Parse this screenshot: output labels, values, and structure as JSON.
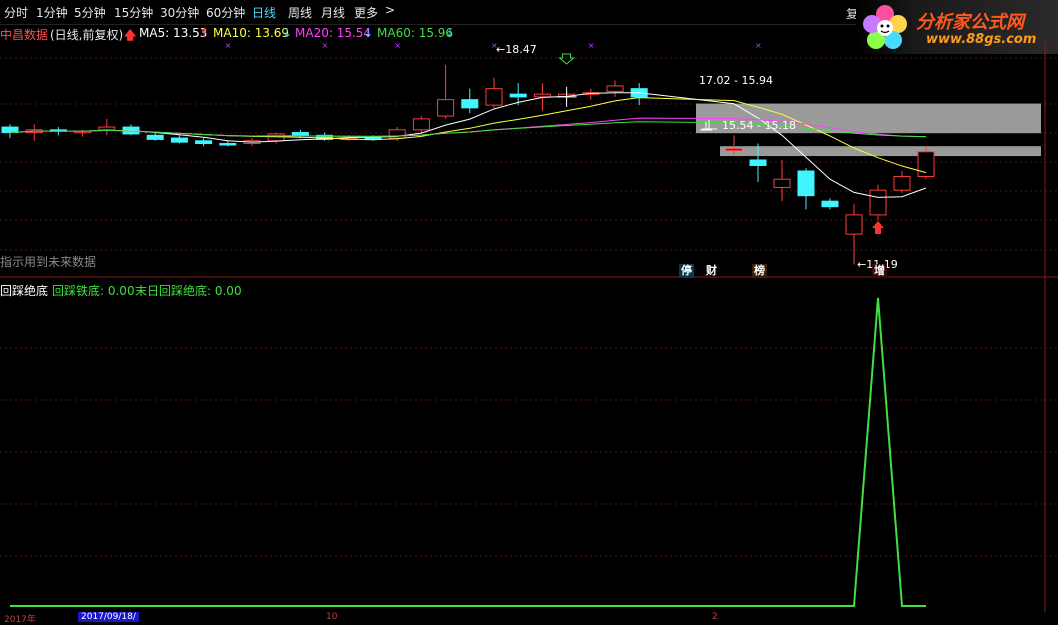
{
  "tabs": [
    "分时",
    "1分钟",
    "5分钟",
    "15分钟",
    "30分钟",
    "60分钟",
    "日线",
    "周线",
    "月线",
    "更多"
  ],
  "active_tab": "日线",
  "restore_label": "复",
  "logo": {
    "brand": "分析家公式网",
    "url": "www.88gs.com"
  },
  "stock": {
    "name": "中昌数据",
    "mode": "(日线,前复权)"
  },
  "ma": [
    {
      "label": "MA5: 13.53",
      "color": "#ffffff",
      "arrow": "↑",
      "arrow_color": "#ff3030"
    },
    {
      "label": "MA10: 13.69",
      "color": "#ffff40",
      "arrow": "↓",
      "arrow_color": "#40d0ff"
    },
    {
      "label": "MA20: 15.54",
      "color": "#ff40ff",
      "arrow": "↓",
      "arrow_color": "#40d0ff"
    },
    {
      "label": "MA60: 15.96",
      "color": "#40e040",
      "arrow": "↓",
      "arrow_color": "#40d0ff"
    }
  ],
  "annotations": {
    "high": "18.47",
    "low": "11.19",
    "zone1": "17.02 - 15.94",
    "zone2": "15.54 - 15.18",
    "future_note": "指示用到未来数据"
  },
  "events": [
    {
      "text": "停",
      "color": "#40d0ff"
    },
    {
      "text": "财",
      "color": "#40d0ff"
    },
    {
      "text": "榜",
      "color": "#ff8a30"
    },
    {
      "text": "增",
      "color": "#ff4040"
    }
  ],
  "lower": {
    "title": "回踩绝底",
    "v1": "回踩铁底: 0.00",
    "v2": "末日回踩绝底: 0.00"
  },
  "date_tag": "2017/09/18/",
  "bottom_labels": [
    "2017年",
    "10",
    "2"
  ],
  "chart_data": {
    "type": "candlestick",
    "ohlc": [
      [
        16.2,
        16.3,
        15.8,
        16.0
      ],
      [
        16.0,
        16.3,
        15.7,
        16.1
      ],
      [
        16.1,
        16.2,
        15.9,
        16.05
      ],
      [
        16.0,
        16.1,
        15.85,
        16.05
      ],
      [
        16.1,
        16.5,
        15.9,
        16.2
      ],
      [
        16.2,
        16.3,
        15.9,
        15.95
      ],
      [
        15.9,
        16.0,
        15.7,
        15.75
      ],
      [
        15.8,
        15.9,
        15.6,
        15.65
      ],
      [
        15.7,
        15.8,
        15.5,
        15.6
      ],
      [
        15.6,
        15.7,
        15.5,
        15.55
      ],
      [
        15.6,
        15.8,
        15.5,
        15.7
      ],
      [
        15.7,
        16.0,
        15.6,
        15.95
      ],
      [
        16.0,
        16.1,
        15.8,
        15.9
      ],
      [
        15.9,
        16.0,
        15.7,
        15.75
      ],
      [
        15.8,
        15.9,
        15.7,
        15.8
      ],
      [
        15.8,
        15.9,
        15.7,
        15.75
      ],
      [
        15.8,
        16.2,
        15.7,
        16.1
      ],
      [
        16.1,
        16.6,
        16.0,
        16.5
      ],
      [
        16.6,
        18.47,
        16.5,
        17.2
      ],
      [
        17.2,
        17.6,
        16.7,
        16.9
      ],
      [
        17.0,
        18.0,
        16.9,
        17.6
      ],
      [
        17.4,
        17.8,
        17.0,
        17.3
      ],
      [
        17.3,
        17.8,
        16.8,
        17.4
      ],
      [
        17.3,
        17.5,
        17.1,
        17.4
      ],
      [
        17.4,
        17.6,
        17.2,
        17.45
      ],
      [
        17.5,
        17.9,
        17.3,
        17.7
      ],
      [
        17.6,
        17.8,
        17.0,
        17.3
      ],
      [
        15.4,
        15.9,
        15.2,
        15.4
      ],
      [
        15.0,
        15.6,
        14.2,
        14.8
      ],
      [
        14.0,
        15.0,
        13.5,
        14.3
      ],
      [
        14.6,
        14.7,
        13.2,
        13.7
      ],
      [
        13.5,
        13.6,
        13.2,
        13.3
      ],
      [
        12.3,
        13.4,
        11.19,
        13.0
      ],
      [
        13.0,
        14.1,
        12.8,
        13.9
      ],
      [
        13.9,
        14.6,
        13.8,
        14.4
      ],
      [
        14.4,
        15.5,
        14.3,
        15.3
      ]
    ],
    "ma5_last": 13.53,
    "ma10_last": 13.69,
    "ma20_last": 15.54,
    "ma60_last": 15.96,
    "lower_series": {
      "name": "回踩绝底",
      "values": [
        0,
        0,
        0,
        0,
        0,
        0,
        0,
        0,
        0,
        0,
        0,
        0,
        0,
        0,
        0,
        0,
        0,
        0,
        0,
        0,
        0,
        0,
        0,
        0,
        0,
        0,
        0,
        0,
        0,
        0,
        0,
        0,
        0,
        1,
        0,
        0
      ]
    }
  }
}
